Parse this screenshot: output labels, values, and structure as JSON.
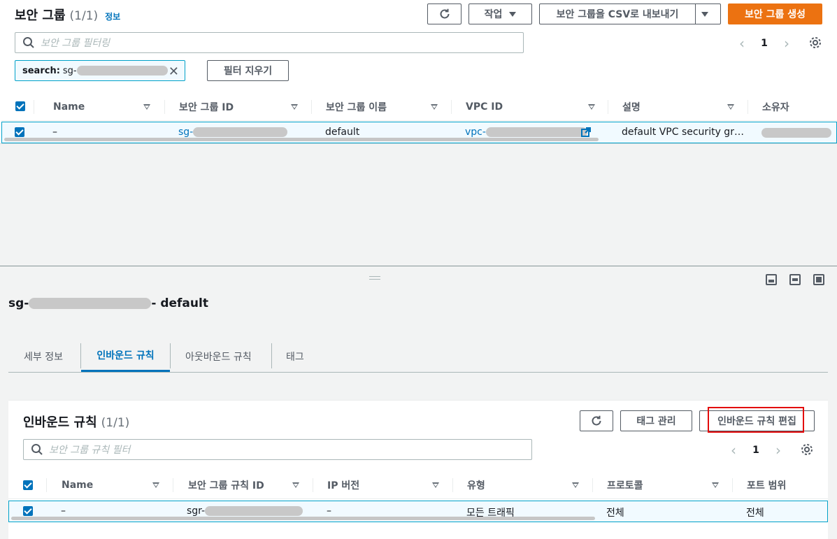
{
  "top": {
    "title": "보안 그룹",
    "count": "(1/1)",
    "info": "정보",
    "refresh_icon": "refresh-icon",
    "actions_label": "작업",
    "export_label": "보안 그룹을 CSV로 내보내기",
    "create_label": "보안 그룹 생성",
    "search_placeholder": "보안 그룹 필터링",
    "page": "1",
    "token_label": "search:",
    "token_value": "sg-",
    "clear_filters": "필터 지우기",
    "columns": [
      "Name",
      "보안 그룹 ID",
      "보안 그룹 이름",
      "VPC ID",
      "설명",
      "소유자"
    ],
    "row": {
      "name": "–",
      "sg_id": "sg-",
      "sg_name": "default",
      "vpc_id": "vpc-",
      "description": "default VPC security gr…"
    }
  },
  "detail": {
    "title_prefix": "sg-",
    "title_suffix": "- default",
    "tabs": [
      "세부 정보",
      "인바운드 규칙",
      "아웃바운드 규칙",
      "태그"
    ]
  },
  "rules": {
    "title": "인바운드 규칙",
    "count": "(1/1)",
    "manage_tags": "태그 관리",
    "edit_rules": "인바운드 규칙 편집",
    "search_placeholder": "보안 그룹 규칙 필터",
    "page": "1",
    "columns": [
      "Name",
      "보안 그룹 규칙 ID",
      "IP 버전",
      "유형",
      "프로토콜",
      "포트 범위"
    ],
    "row": {
      "name": "–",
      "rule_id": "sgr-",
      "ip_version": "–",
      "type": "모든 트래픽",
      "protocol": "전체",
      "port_range": "전체"
    }
  },
  "colors": {
    "accent": "#0073bb",
    "primary": "#ec7211",
    "highlight": "#e30b0b"
  }
}
